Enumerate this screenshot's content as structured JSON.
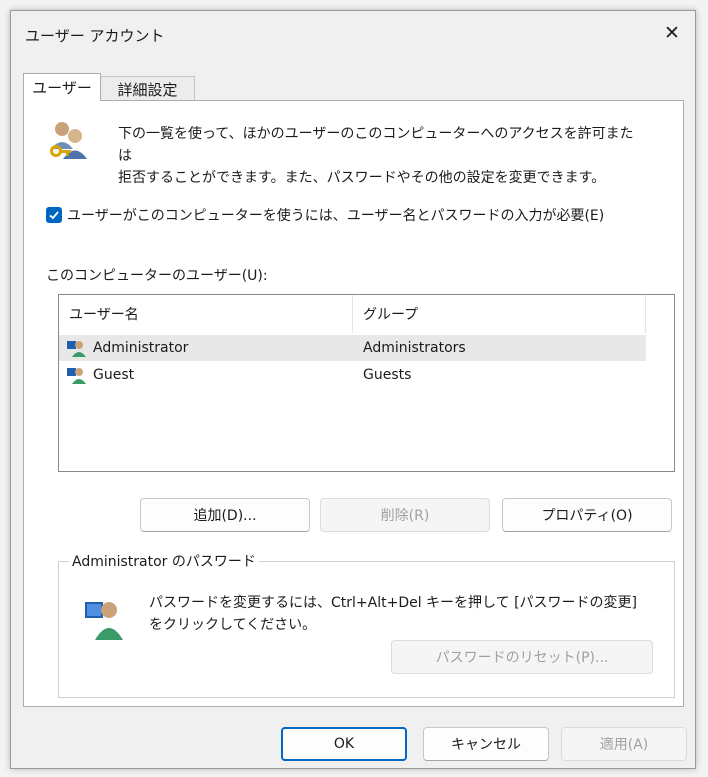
{
  "window": {
    "title": "ユーザー アカウント",
    "close_label": "✕"
  },
  "tabs": [
    {
      "label": "ユーザー",
      "active": true
    },
    {
      "label": "詳細設定",
      "active": false
    }
  ],
  "intro": {
    "line1": "下の一覧を使って、ほかのユーザーのこのコンピューターへのアクセスを許可または",
    "line2": "拒否することができます。また、パスワードやその他の設定を変更できます。"
  },
  "require_password": {
    "label": "ユーザーがこのコンピューターを使うには、ユーザー名とパスワードの入力が必要(E)",
    "checked": true
  },
  "users_label": "このコンピューターのユーザー(U):",
  "users_table": {
    "columns": [
      "ユーザー名",
      "グループ"
    ],
    "rows": [
      {
        "name": "Administrator",
        "group": "Administrators",
        "selected": true
      },
      {
        "name": "Guest",
        "group": "Guests",
        "selected": false
      }
    ]
  },
  "user_buttons": {
    "add": "追加(D)...",
    "remove": "削除(R)",
    "properties": "プロパティ(O)"
  },
  "password_group": {
    "title": "Administrator のパスワード",
    "line1": "パスワードを変更するには、Ctrl+Alt+Del キーを押して [パスワードの変更]",
    "line2": "をクリックしてください。",
    "reset_button": "パスワードのリセット(P)..."
  },
  "dialog_buttons": {
    "ok": "OK",
    "cancel": "キャンセル",
    "apply": "適用(A)"
  },
  "colors": {
    "accent": "#0067c0",
    "selected_row": "#e8e8e8",
    "disabled_text": "#a0a0a0"
  }
}
